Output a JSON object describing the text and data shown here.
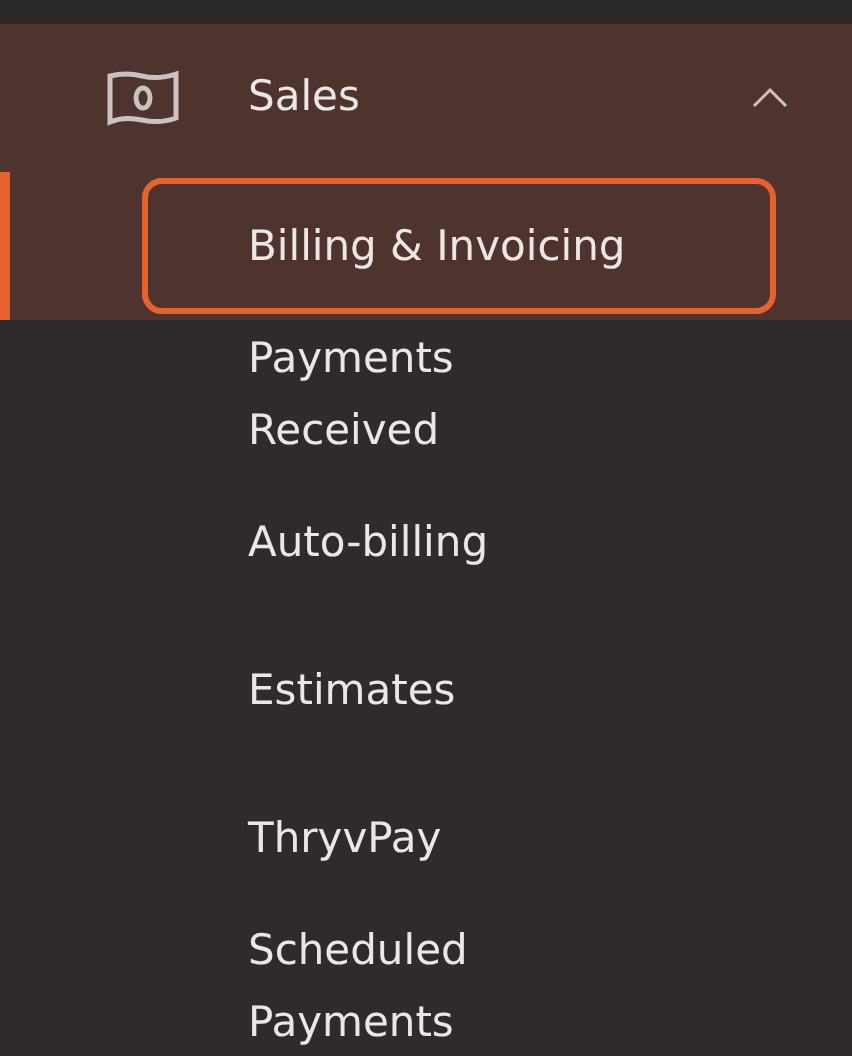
{
  "section": {
    "label": "Sales",
    "expanded": true
  },
  "items": [
    {
      "label": "Billing & Invoicing",
      "selected": true
    },
    {
      "label": "Payments\nReceived",
      "selected": false
    },
    {
      "label": "Auto-billing",
      "selected": false
    },
    {
      "label": "Estimates",
      "selected": false
    },
    {
      "label": "ThryvPay",
      "selected": false
    },
    {
      "label": "Scheduled\nPayments",
      "selected": false
    }
  ]
}
